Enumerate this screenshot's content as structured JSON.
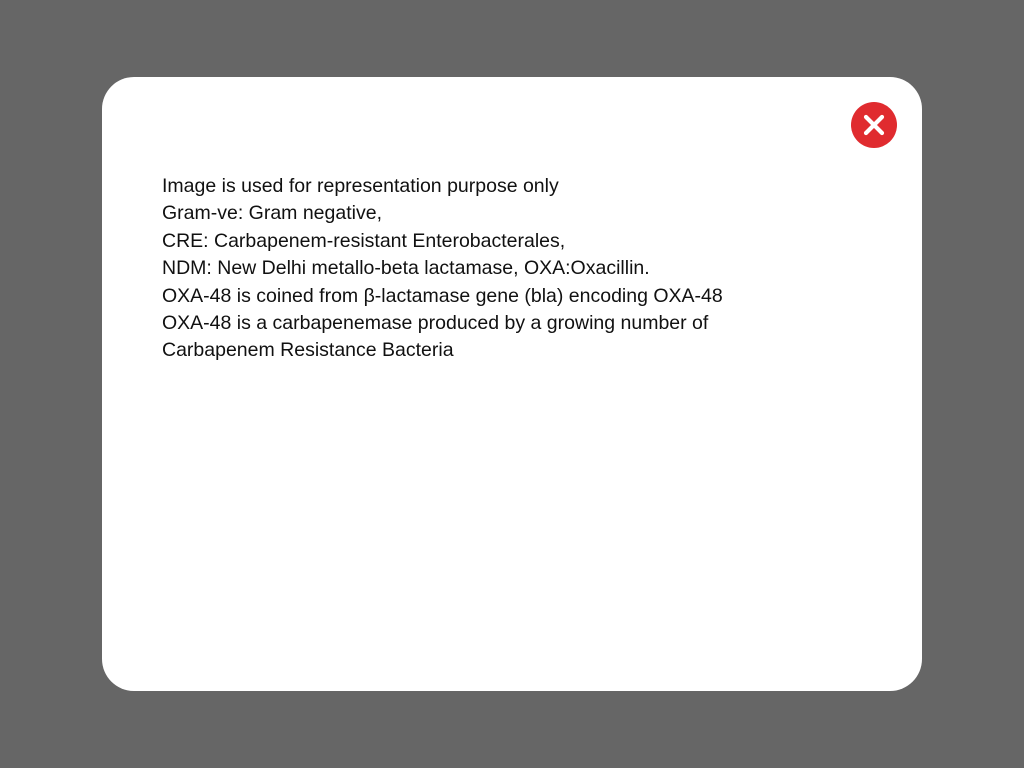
{
  "colors": {
    "backdrop": "#666666",
    "modal_background": "#ffffff",
    "close_button": "#e02b2f",
    "text": "#111111"
  },
  "modal": {
    "close_icon": "close-icon",
    "lines": [
      "Image is used for representation purpose only",
      "Gram-ve: Gram negative,",
      "CRE: Carbapenem-resistant Enterobacterales,",
      "NDM: New Delhi metallo-beta lactamase, OXA:Oxacillin.",
      "OXA-48 is coined from β-lactamase gene (bla) encoding OXA-48",
      "OXA-48 is a carbapenemase produced by a growing number of",
      "Carbapenem Resistance Bacteria"
    ]
  }
}
